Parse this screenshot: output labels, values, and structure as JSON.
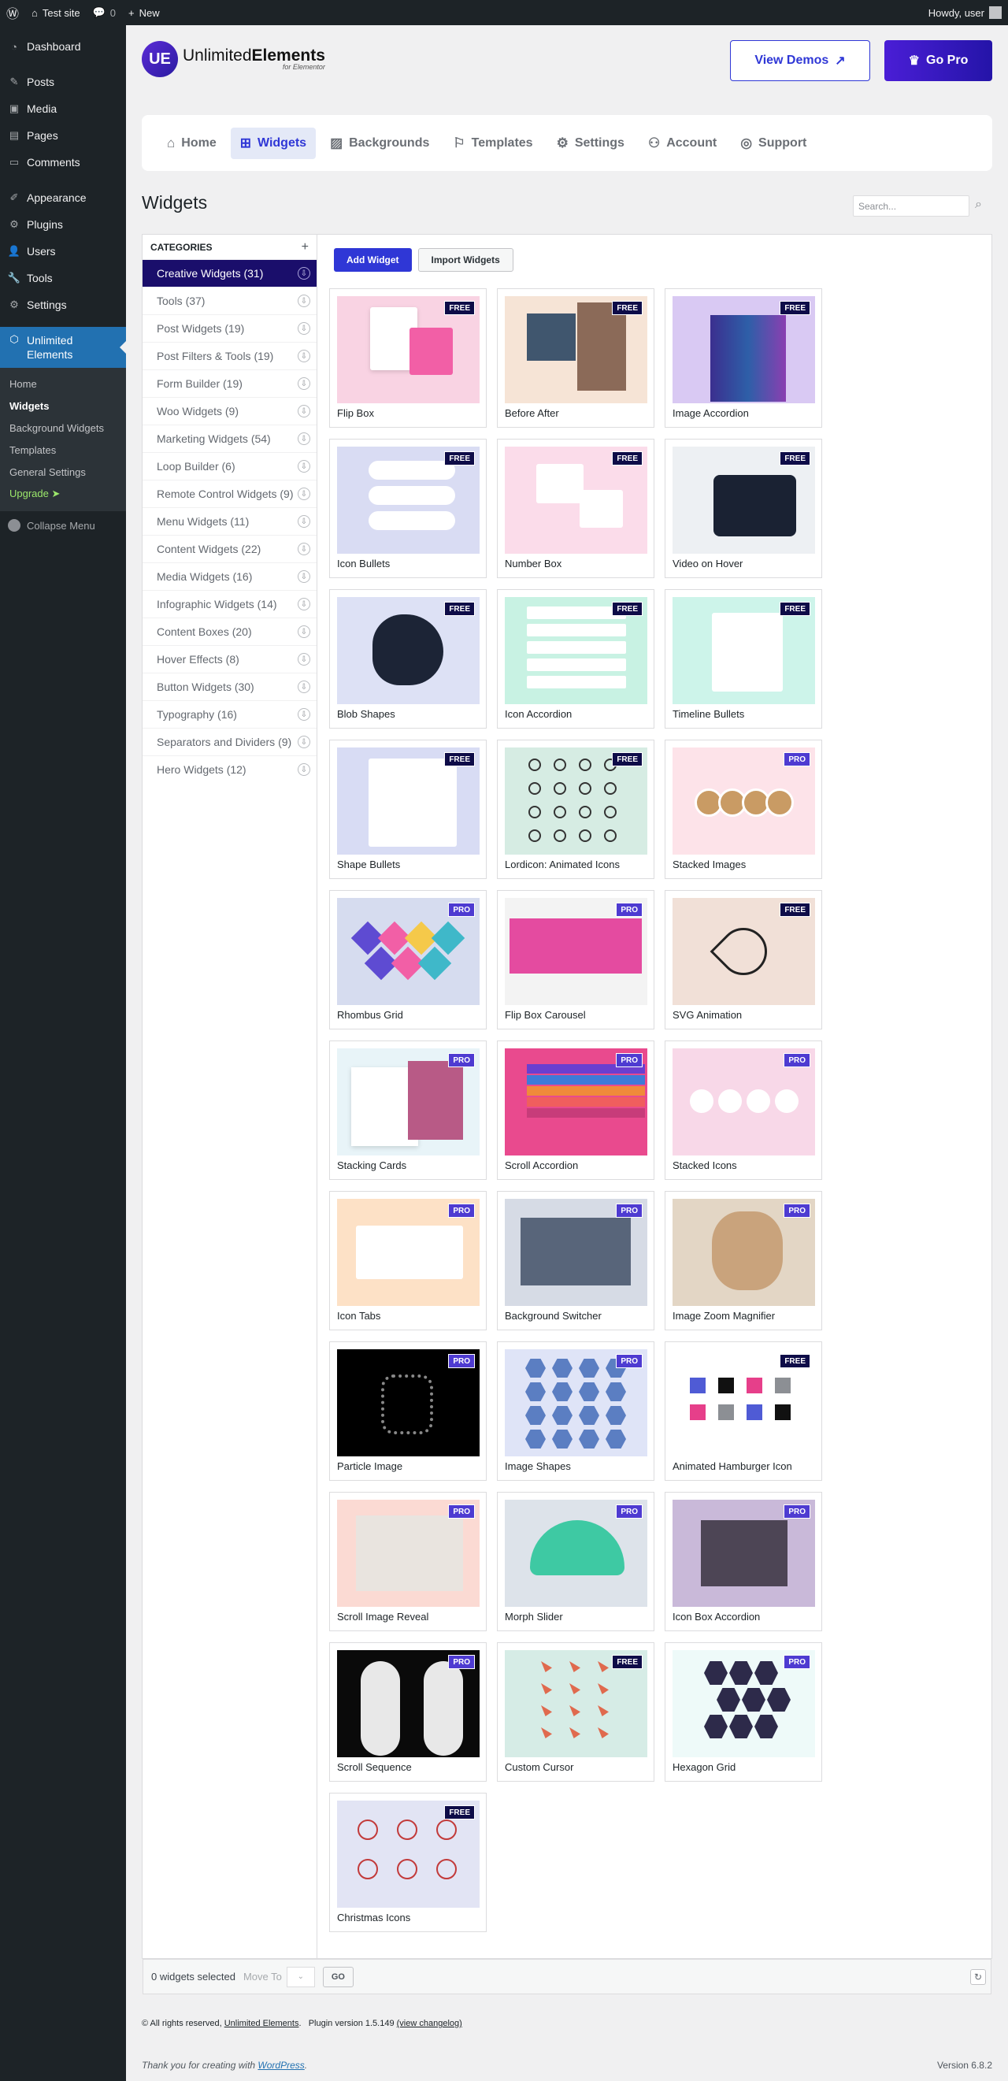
{
  "adminbar": {
    "site_name": "Test site",
    "comments_count": "0",
    "new_label": "New",
    "howdy": "Howdy, user"
  },
  "sidebar": {
    "items": [
      {
        "label": "Dashboard",
        "icon": "dashboard-icon"
      },
      {
        "label": "Posts",
        "icon": "pin-icon"
      },
      {
        "label": "Media",
        "icon": "media-icon"
      },
      {
        "label": "Pages",
        "icon": "pages-icon"
      },
      {
        "label": "Comments",
        "icon": "comments-icon"
      },
      {
        "label": "Appearance",
        "icon": "brush-icon"
      },
      {
        "label": "Plugins",
        "icon": "plugin-icon"
      },
      {
        "label": "Users",
        "icon": "users-icon"
      },
      {
        "label": "Tools",
        "icon": "wrench-icon"
      },
      {
        "label": "Settings",
        "icon": "settings-icon"
      }
    ],
    "current": "Unlimited Elements",
    "submenu": [
      "Home",
      "Widgets",
      "Background Widgets",
      "Templates",
      "General Settings",
      "Upgrade ➤"
    ],
    "collapse": "Collapse Menu"
  },
  "header": {
    "logo_main": "Unlimited",
    "logo_bold": "Elements",
    "logo_sub": "for Elementor",
    "view_demos": "View Demos",
    "go_pro": "Go Pro"
  },
  "nav": {
    "tabs": [
      "Home",
      "Widgets",
      "Backgrounds",
      "Templates",
      "Settings",
      "Account",
      "Support"
    ]
  },
  "page": {
    "title": "Widgets",
    "search_placeholder": "Search..."
  },
  "categories": {
    "heading": "CATEGORIES",
    "items": [
      "Creative Widgets (31)",
      "Tools (37)",
      "Post Widgets (19)",
      "Post Filters & Tools (19)",
      "Form Builder (19)",
      "Woo Widgets (9)",
      "Marketing Widgets (54)",
      "Loop Builder (6)",
      "Remote Control Widgets (9)",
      "Menu Widgets (11)",
      "Content Widgets (22)",
      "Media Widgets (16)",
      "Infographic Widgets (14)",
      "Content Boxes (20)",
      "Hover Effects (8)",
      "Button Widgets (30)",
      "Typography (16)",
      "Separators and Dividers (9)",
      "Hero Widgets (12)"
    ]
  },
  "toolbar": {
    "add_widget": "Add Widget",
    "import_widgets": "Import Widgets"
  },
  "widgets": [
    {
      "name": "Flip Box",
      "badge": "FREE",
      "bg": "#f9d3e3"
    },
    {
      "name": "Before After",
      "badge": "FREE",
      "bg": "#f6e4d6"
    },
    {
      "name": "Image Accordion",
      "badge": "FREE",
      "bg": "#d9c9f3"
    },
    {
      "name": "Icon Bullets",
      "badge": "FREE",
      "bg": "#d9dcf3"
    },
    {
      "name": "Number Box",
      "badge": "FREE",
      "bg": "#fbdcea"
    },
    {
      "name": "Video on Hover",
      "badge": "FREE",
      "bg": "#edf0f3"
    },
    {
      "name": "Blob Shapes",
      "badge": "FREE",
      "bg": "#dde1f5"
    },
    {
      "name": "Icon Accordion",
      "badge": "FREE",
      "bg": "#c8f2e3"
    },
    {
      "name": "Timeline Bullets",
      "badge": "FREE",
      "bg": "#cdf4ea"
    },
    {
      "name": "Shape Bullets",
      "badge": "FREE",
      "bg": "#d8dcf4"
    },
    {
      "name": "Lordicon: Animated Icons",
      "badge": "FREE",
      "bg": "#d6ece3"
    },
    {
      "name": "Stacked Images",
      "badge": "PRO",
      "bg": "#fde3e9"
    },
    {
      "name": "Rhombus Grid",
      "badge": "PRO",
      "bg": "#d6dcef"
    },
    {
      "name": "Flip Box Carousel",
      "badge": "PRO",
      "bg": "#f3f3f3"
    },
    {
      "name": "SVG Animation",
      "badge": "FREE",
      "bg": "#f1e0d7"
    },
    {
      "name": "Stacking Cards",
      "badge": "PRO",
      "bg": "#e8f4f8"
    },
    {
      "name": "Scroll Accordion",
      "badge": "PRO",
      "bg": "#e94a8e"
    },
    {
      "name": "Stacked Icons",
      "badge": "PRO",
      "bg": "#f8d8e8"
    },
    {
      "name": "Icon Tabs",
      "badge": "PRO",
      "bg": "#fde1c6"
    },
    {
      "name": "Background Switcher",
      "badge": "PRO",
      "bg": "#d6dbe5"
    },
    {
      "name": "Image Zoom Magnifier",
      "badge": "PRO",
      "bg": "#e3d6c5"
    },
    {
      "name": "Particle Image",
      "badge": "PRO",
      "bg": "#000000"
    },
    {
      "name": "Image Shapes",
      "badge": "PRO",
      "bg": "#dfe4f7"
    },
    {
      "name": "Animated Hamburger Icon",
      "badge": "FREE",
      "bg": "#ffffff"
    },
    {
      "name": "Scroll Image Reveal",
      "badge": "PRO",
      "bg": "#fbdad3"
    },
    {
      "name": "Morph Slider",
      "badge": "PRO",
      "bg": "#dde3ea"
    },
    {
      "name": "Icon Box Accordion",
      "badge": "PRO",
      "bg": "#c9b9d9"
    },
    {
      "name": "Scroll Sequence",
      "badge": "PRO",
      "bg": "#0a0a0a"
    },
    {
      "name": "Custom Cursor",
      "badge": "FREE",
      "bg": "#d6ece6"
    },
    {
      "name": "Hexagon Grid",
      "badge": "PRO",
      "bg": "#eefaf9"
    },
    {
      "name": "Christmas Icons",
      "badge": "FREE",
      "bg": "#e2e4f4"
    }
  ],
  "footerbar": {
    "selected": "0 widgets selected",
    "move_to": "Move To",
    "go": "GO"
  },
  "footer": {
    "copyright_prefix": "© All rights reserved,",
    "copyright_link": "Unlimited Elements",
    "plugin_version": "Plugin version 1.5.149",
    "changelog": "(view changelog)",
    "thanks_prefix": "Thank you for creating with",
    "thanks_link": "WordPress",
    "thanks_suffix": ".",
    "version": "Version 6.8.2"
  },
  "colors": {
    "accent": "#2f37d6",
    "brand_dark": "#1a0e6b",
    "admin_bar": "#1d2327",
    "sidebar_current": "#2271b1"
  }
}
